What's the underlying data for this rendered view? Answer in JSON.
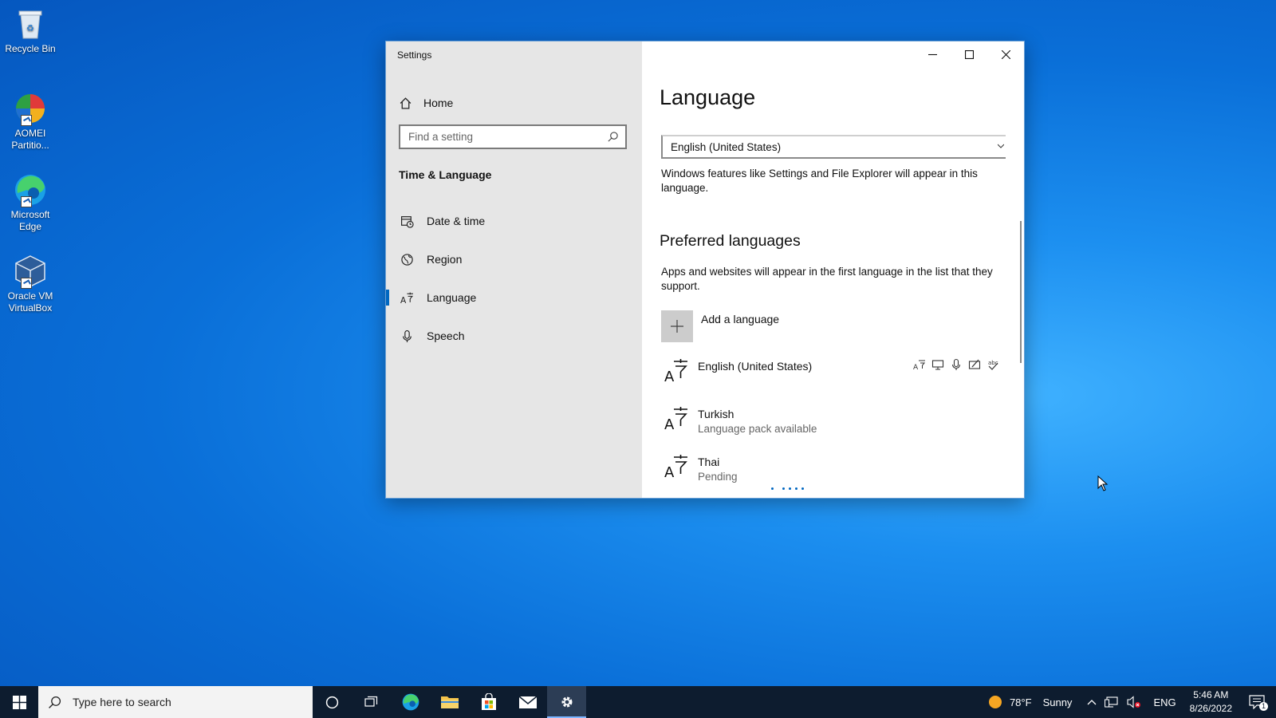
{
  "desktop": {
    "icons": [
      {
        "label": "Recycle Bin"
      },
      {
        "label": "AOMEI Partitio..."
      },
      {
        "label": "Microsoft Edge"
      },
      {
        "label": "Oracle VM VirtualBox"
      }
    ]
  },
  "window": {
    "title": "Settings",
    "sidebar": {
      "home_label": "Home",
      "search_placeholder": "Find a setting",
      "section_title": "Time & Language",
      "items": [
        {
          "label": "Date & time",
          "icon": "calendar-clock-icon"
        },
        {
          "label": "Region",
          "icon": "globe-icon"
        },
        {
          "label": "Language",
          "icon": "language-icon",
          "active": true
        },
        {
          "label": "Speech",
          "icon": "microphone-icon"
        }
      ]
    },
    "content": {
      "page_title": "Language",
      "display_language_value": "English (United States)",
      "display_language_desc": "Windows features like Settings and File Explorer will appear in this language.",
      "preferred_title": "Preferred languages",
      "preferred_desc": "Apps and websites will appear in the first language in the list that they support.",
      "add_language_label": "Add a language",
      "languages": [
        {
          "name": "English (United States)",
          "status": "",
          "features": [
            "language-pack-icon",
            "display-icon",
            "microphone-icon",
            "handwriting-icon",
            "spellcheck-icon"
          ]
        },
        {
          "name": "Turkish",
          "status": "Language pack available"
        },
        {
          "name": "Thai",
          "status": "Pending"
        }
      ]
    }
  },
  "taskbar": {
    "search_placeholder": "Type here to search",
    "pinned_apps": [
      "cortana",
      "task-view",
      "edge",
      "file-explorer",
      "store",
      "mail",
      "settings"
    ],
    "active_app": "settings",
    "weather": {
      "temp": "78°F",
      "condition": "Sunny"
    },
    "input_lang": "ENG",
    "time": "5:46 AM",
    "date": "8/26/2022",
    "notification_count": "1"
  }
}
